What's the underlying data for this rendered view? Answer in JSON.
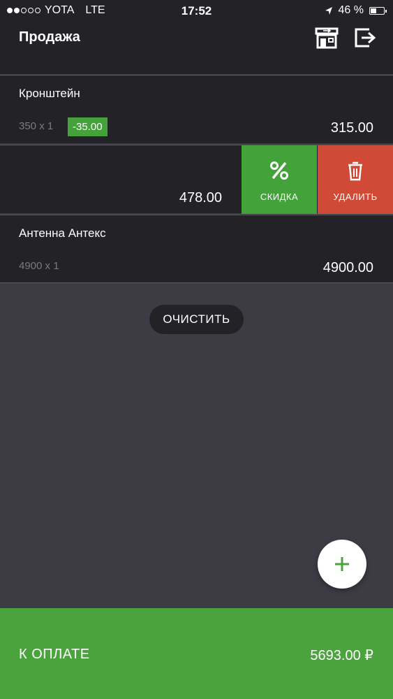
{
  "status_bar": {
    "carrier": "YOTA",
    "network": "LTE",
    "time": "17:52",
    "battery": "46 %",
    "battery_level": 0.46,
    "signal_bars_filled": 2,
    "signal_bars_total": 5
  },
  "header": {
    "title": "Продажа",
    "icons": [
      "store-icon",
      "exit-icon"
    ]
  },
  "items": [
    {
      "name": "Кронштейн",
      "qty": "350 x 1",
      "discount": "-35.00",
      "price": "315.00"
    },
    {
      "name": "",
      "qty": "",
      "discount": "",
      "price": "478.00"
    },
    {
      "name": "Антенна Антекс",
      "qty": "4900 x 1",
      "discount": "",
      "price": "4900.00"
    }
  ],
  "swipe_actions": {
    "discount_label": "СКИДКА",
    "delete_label": "УДАЛИТЬ",
    "discount_icon": "percent-icon",
    "delete_icon": "trash-icon"
  },
  "clear_label": "ОЧИСТИТЬ",
  "add_icon": "plus-icon",
  "footer": {
    "label": "К ОПЛАТЕ",
    "total": "5693.00 ₽"
  },
  "colors": {
    "accent_green": "#4aa33c",
    "delete_red": "#d04a36",
    "header_bg": "#232226",
    "content_bg": "#3d3c45"
  }
}
